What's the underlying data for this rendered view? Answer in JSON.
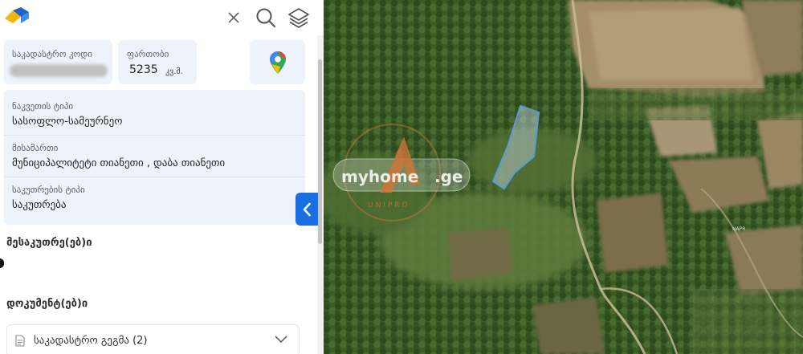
{
  "search": {
    "value": "",
    "placeholder": ""
  },
  "toolbar": {
    "clear_icon": "close-icon",
    "search_icon": "search-icon",
    "layers_icon": "layers-icon"
  },
  "cadastral": {
    "label": "საკადასტრო კოდი"
  },
  "area": {
    "label": "ფართობი",
    "value": "5235",
    "unit": "კვ.მ."
  },
  "map_link": {
    "icon": "google-maps-pin-icon"
  },
  "info": {
    "building_type": {
      "label": "ნაკვეთის ტიპი",
      "value": "სასოფლო-სამეურნეო"
    },
    "address": {
      "label": "მისამართი",
      "value": "მუნიციპალიტეტი თიანეთი , დაბა თიანეთი"
    },
    "ownership": {
      "label": "საკუთრების ტიპი",
      "value": "საკუთრება"
    }
  },
  "sections": {
    "owners": "მესაკუთრე(ებ)ი",
    "documents": "დოკუმენტ(ებ)ი"
  },
  "documents": [
    {
      "label": "საკადასტრო გეგმა (2)",
      "icon": "document-icon"
    }
  ],
  "map": {
    "watermark_name": "myhome",
    "watermark_suffix": ".ge",
    "watermark_sub": "UNIPRO",
    "place_label": "NAPR"
  },
  "colors": {
    "accent": "#1a6ee4",
    "card": "#eef3fb",
    "parcel_outline": "#5b9bd5"
  }
}
